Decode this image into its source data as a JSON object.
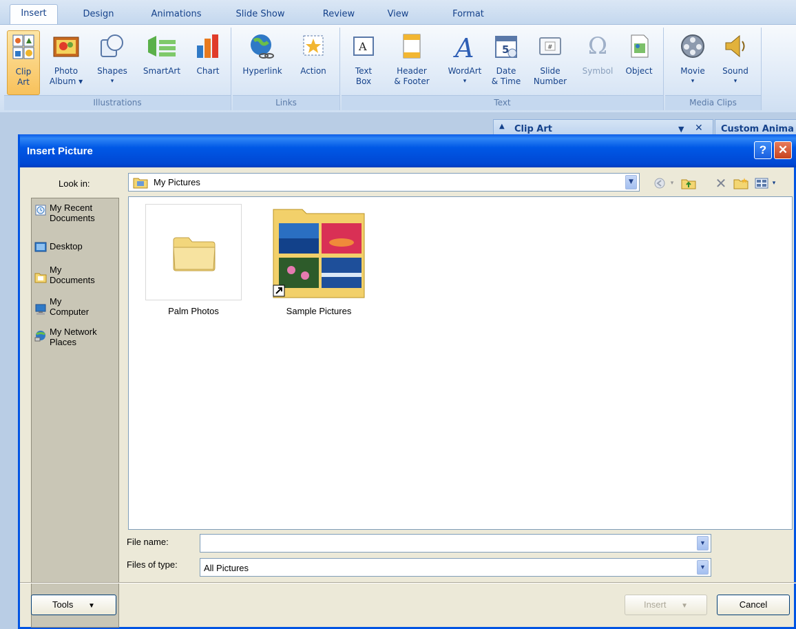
{
  "ribbon": {
    "tabs": [
      "Insert",
      "Design",
      "Animations",
      "Slide Show",
      "Review",
      "View",
      "Format"
    ],
    "active_tab": "Insert",
    "groups": {
      "illustrations": "Illustrations",
      "links": "Links",
      "text": "Text",
      "media": "Media Clips"
    },
    "buttons": {
      "clip_art": [
        "Clip",
        "Art"
      ],
      "photo_album": [
        "Photo",
        "Album"
      ],
      "shapes": "Shapes",
      "smartart": "SmartArt",
      "chart": "Chart",
      "hyperlink": "Hyperlink",
      "action": "Action",
      "text_box": [
        "Text",
        "Box"
      ],
      "header_footer": [
        "Header",
        "& Footer"
      ],
      "wordart": "WordArt",
      "date_time": [
        "Date",
        "& Time"
      ],
      "slide_number": [
        "Slide",
        "Number"
      ],
      "symbol": "Symbol",
      "object": "Object",
      "movie": "Movie",
      "sound": "Sound"
    }
  },
  "task_pane": {
    "clip_art_title": "Clip Art",
    "custom_animation_title": "Custom Anima"
  },
  "dialog": {
    "title": "Insert Picture",
    "look_in_label": "Look in:",
    "look_in_value": "My Pictures",
    "places": [
      [
        "My Recent",
        "Documents"
      ],
      [
        "Desktop"
      ],
      [
        "My",
        "Documents"
      ],
      [
        "My",
        "Computer"
      ],
      [
        "My Network",
        "Places"
      ]
    ],
    "files": [
      "Palm Photos",
      "Sample Pictures"
    ],
    "file_name_label": "File name:",
    "file_name_value": "",
    "files_of_type_label": "Files of type:",
    "files_of_type_value": "All Pictures",
    "tools_button": "Tools",
    "insert_button": "Insert",
    "cancel_button": "Cancel"
  }
}
